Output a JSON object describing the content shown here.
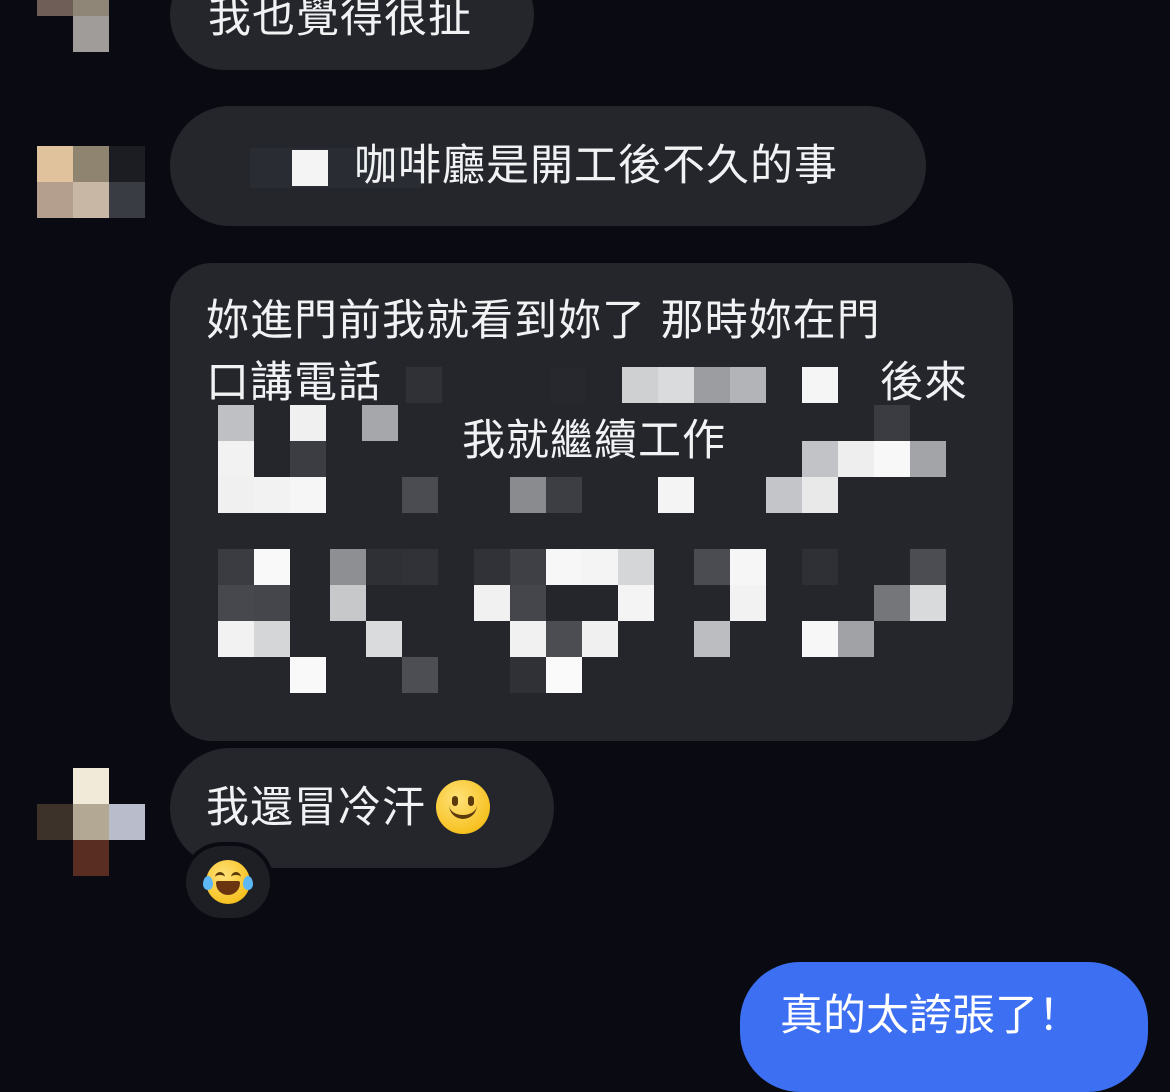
{
  "messages": [
    {
      "id": "msg1",
      "text": "我也覺得很扯",
      "direction": "incoming"
    },
    {
      "id": "msg2",
      "text": "咖啡廳是開工後不久的事",
      "direction": "incoming",
      "partially_redacted": true
    },
    {
      "id": "msg3",
      "lines": [
        "妳進門前我就看到妳了 那時妳在門",
        "口講電話",
        "後來",
        "我就繼續工作"
      ],
      "direction": "incoming",
      "partially_redacted": true
    },
    {
      "id": "msg4",
      "text": "我還冒冷汗",
      "emoji": "slightly-smiling-face",
      "direction": "incoming",
      "reaction": "face-with-tears-of-joy"
    },
    {
      "id": "msg5",
      "text": "真的太誇張了！",
      "direction": "outgoing"
    }
  ],
  "colors": {
    "background": "#0a0b12",
    "incoming_bubble": "#24262c",
    "outgoing_bubble": "#3d6ff2",
    "text": "#f1f2f4"
  }
}
